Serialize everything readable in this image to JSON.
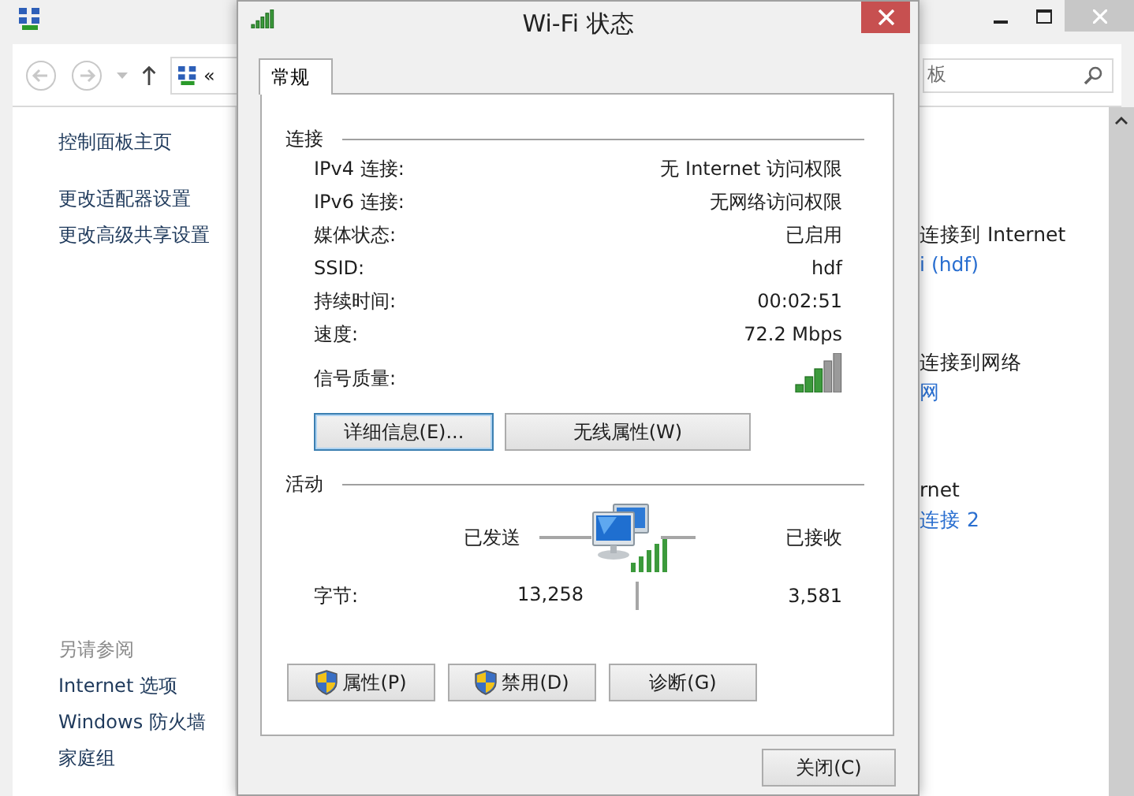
{
  "explorer": {
    "address": {
      "text": "«"
    },
    "search": {
      "placeholder": "板"
    },
    "sidebar_links": [
      "控制面板主页",
      "更改适配器设置",
      "更改高级共享设置"
    ],
    "see_also": {
      "title": "另请参阅",
      "links": [
        "Internet 选项",
        "Windows 防火墙",
        "家庭组"
      ]
    },
    "content_items": [
      {
        "title": "连接到 Internet",
        "link": "i (hdf)"
      },
      {
        "title": "连接到网络",
        "link": "网"
      },
      {
        "title": "rnet",
        "link": "连接 2"
      }
    ]
  },
  "dialog": {
    "title": "Wi-Fi 状态",
    "tabs": [
      {
        "label": "常规",
        "selected": true
      }
    ],
    "connection": {
      "title": "连接",
      "rows": [
        {
          "label": "IPv4 连接:",
          "value": "无 Internet 访问权限"
        },
        {
          "label": "IPv6 连接:",
          "value": "无网络访问权限"
        },
        {
          "label": "媒体状态:",
          "value": "已启用"
        },
        {
          "label": "SSID:",
          "value": "hdf"
        },
        {
          "label": "持续时间:",
          "value": "00:02:51"
        },
        {
          "label": "速度:",
          "value": "72.2 Mbps"
        }
      ],
      "signal_label": "信号质量:",
      "buttons": [
        {
          "label": "详细信息(E)...",
          "focused": true
        },
        {
          "label": "无线属性(W)",
          "focused": false
        }
      ]
    },
    "activity": {
      "title": "活动",
      "sent_label": "已发送",
      "received_label": "已接收",
      "bytes_label": "字节:",
      "sent": "13,258",
      "received": "3,581"
    },
    "action_buttons": [
      {
        "label": "属性(P)",
        "shield": true
      },
      {
        "label": "禁用(D)",
        "shield": true
      },
      {
        "label": "诊断(G)",
        "shield": false
      }
    ],
    "close_button": "关闭(C)"
  }
}
